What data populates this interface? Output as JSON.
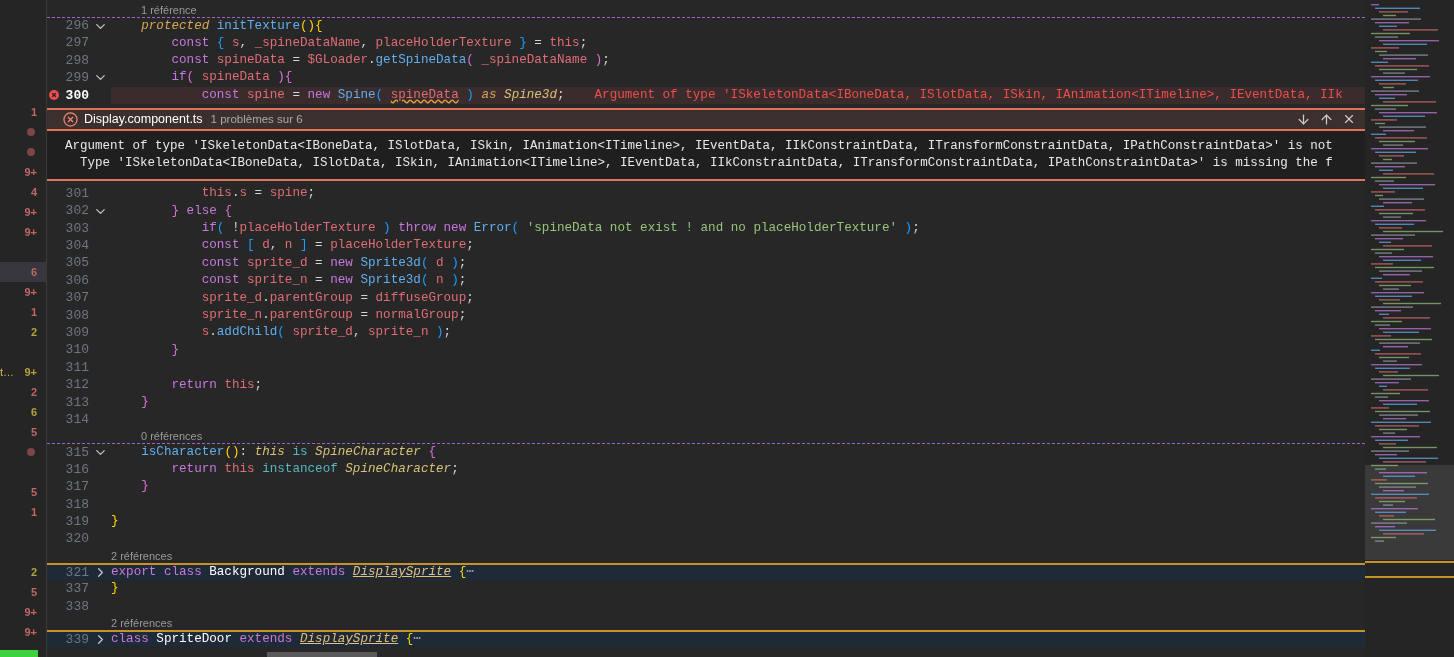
{
  "explorer": {
    "rows": [
      {
        "kind": "count",
        "text": "1",
        "color": "#c26565",
        "selected": false
      },
      {
        "kind": "dot",
        "color": "#7d4545",
        "selected": false
      },
      {
        "kind": "dot",
        "color": "#7d4545",
        "selected": false
      },
      {
        "kind": "count",
        "text": "9+",
        "color": "#c26565",
        "selected": false
      },
      {
        "kind": "count",
        "text": "4",
        "color": "#c26565",
        "selected": false
      },
      {
        "kind": "count",
        "text": "9+",
        "color": "#c26565",
        "selected": false
      },
      {
        "kind": "count",
        "text": "9+",
        "color": "#c26565",
        "selected": false
      },
      {
        "kind": "empty",
        "selected": false
      },
      {
        "kind": "count",
        "text": "6",
        "color": "#c26565",
        "selected": true
      },
      {
        "kind": "count",
        "text": "9+",
        "color": "#c26565",
        "selected": false
      },
      {
        "kind": "count",
        "text": "1",
        "color": "#c26565",
        "selected": false
      },
      {
        "kind": "count",
        "text": "2",
        "color": "#b3a23c",
        "selected": false
      },
      {
        "kind": "empty",
        "selected": false
      },
      {
        "kind": "count",
        "label": "t…",
        "text": "9+",
        "color": "#b3a23c",
        "selected": false
      },
      {
        "kind": "count",
        "text": "2",
        "color": "#c26565",
        "selected": false
      },
      {
        "kind": "count",
        "text": "6",
        "color": "#b3a23c",
        "selected": false
      },
      {
        "kind": "count",
        "text": "5",
        "color": "#c26565",
        "selected": false
      },
      {
        "kind": "dot",
        "color": "#7d4545",
        "selected": false
      },
      {
        "kind": "empty",
        "selected": false
      },
      {
        "kind": "count",
        "text": "5",
        "color": "#c26565",
        "selected": false
      },
      {
        "kind": "count",
        "text": "1",
        "color": "#c26565",
        "selected": false
      },
      {
        "kind": "empty",
        "selected": false
      },
      {
        "kind": "empty",
        "selected": false
      },
      {
        "kind": "count",
        "text": "2",
        "color": "#b3a23c",
        "selected": false
      },
      {
        "kind": "count",
        "text": "5",
        "color": "#c26565",
        "selected": false
      },
      {
        "kind": "count",
        "text": "9+",
        "color": "#c26565",
        "selected": false
      },
      {
        "kind": "count",
        "text": "9+",
        "color": "#c26565",
        "selected": false
      }
    ]
  },
  "editor": {
    "lines": [
      {
        "number": "296",
        "collapsed": false,
        "codelens": "1 référence",
        "tokens": [
          {
            "text": "    protected ",
            "kind": "kwi"
          },
          {
            "text": "initTexture",
            "kind": "fn"
          },
          {
            "text": "(){",
            "kind": "b1"
          }
        ]
      },
      {
        "number": "297",
        "tokens": [
          {
            "text": "        const ",
            "kind": "kw"
          },
          {
            "text": "{ ",
            "kind": "b3"
          },
          {
            "text": "s",
            "kind": "var"
          },
          {
            "text": ", ",
            "kind": "p"
          },
          {
            "text": "_spineDataName",
            "kind": "var"
          },
          {
            "text": ", ",
            "kind": "p"
          },
          {
            "text": "placeHolderTexture ",
            "kind": "var"
          },
          {
            "text": "}",
            "kind": "b3"
          },
          {
            "text": " = ",
            "kind": "p"
          },
          {
            "text": "this",
            "kind": "var"
          },
          {
            "text": ";",
            "kind": "p"
          }
        ]
      },
      {
        "number": "298",
        "tokens": [
          {
            "text": "        const ",
            "kind": "kw"
          },
          {
            "text": "spineData",
            "kind": "var"
          },
          {
            "text": " = ",
            "kind": "p"
          },
          {
            "text": "$GLoader",
            "kind": "var"
          },
          {
            "text": ".",
            "kind": "p"
          },
          {
            "text": "getSpineData",
            "kind": "fn"
          },
          {
            "text": "( ",
            "kind": "b2"
          },
          {
            "text": "_spineDataName ",
            "kind": "var"
          },
          {
            "text": ")",
            "kind": "b2"
          },
          {
            "text": ";",
            "kind": "p"
          }
        ]
      },
      {
        "number": "299",
        "collapsed": false,
        "tokens": [
          {
            "text": "        if",
            "kind": "kw"
          },
          {
            "text": "( ",
            "kind": "b2"
          },
          {
            "text": "spineData ",
            "kind": "var"
          },
          {
            "text": ")",
            "kind": "b2"
          },
          {
            "text": "{",
            "kind": "b2"
          }
        ]
      },
      {
        "number": "300",
        "error": true,
        "diagnostic": "Argument of type 'ISkeletonData<IBoneData, ISlotData, ISkin, IAnimation<ITimeline>, IEventData, IIk",
        "tokens": [
          {
            "text": "            const ",
            "kind": "kw"
          },
          {
            "text": "spine",
            "kind": "var"
          },
          {
            "text": " = ",
            "kind": "p"
          },
          {
            "text": "new ",
            "kind": "kw"
          },
          {
            "text": "Spine",
            "kind": "fn"
          },
          {
            "text": "( ",
            "kind": "b3"
          },
          {
            "text": "spineData",
            "kind": "err"
          },
          {
            "text": " )",
            "kind": "b3"
          },
          {
            "text": " as ",
            "kind": "kwi"
          },
          {
            "text": "Spine3d",
            "kind": "type"
          },
          {
            "text": ";",
            "kind": "p"
          }
        ]
      },
      {
        "number": "301",
        "tokens": [
          {
            "text": "            this",
            "kind": "var"
          },
          {
            "text": ".",
            "kind": "p"
          },
          {
            "text": "s",
            "kind": "var"
          },
          {
            "text": " = ",
            "kind": "p"
          },
          {
            "text": "spine",
            "kind": "var"
          },
          {
            "text": ";",
            "kind": "p"
          }
        ]
      },
      {
        "number": "302",
        "collapsed": false,
        "tokens": [
          {
            "text": "        } ",
            "kind": "b2"
          },
          {
            "text": "else ",
            "kind": "kw"
          },
          {
            "text": "{",
            "kind": "b2"
          }
        ]
      },
      {
        "number": "303",
        "tokens": [
          {
            "text": "            if",
            "kind": "kw"
          },
          {
            "text": "( ",
            "kind": "b3"
          },
          {
            "text": "!",
            "kind": "p"
          },
          {
            "text": "placeHolderTexture ",
            "kind": "var"
          },
          {
            "text": ") ",
            "kind": "b3"
          },
          {
            "text": "throw new ",
            "kind": "kw"
          },
          {
            "text": "Error",
            "kind": "fn"
          },
          {
            "text": "( ",
            "kind": "b3"
          },
          {
            "text": "'spineData not exist ! and no placeHolderTexture'",
            "kind": "str"
          },
          {
            "text": " )",
            "kind": "b3"
          },
          {
            "text": ";",
            "kind": "p"
          }
        ]
      },
      {
        "number": "304",
        "tokens": [
          {
            "text": "            const ",
            "kind": "kw"
          },
          {
            "text": "[ ",
            "kind": "b3"
          },
          {
            "text": "d",
            "kind": "var"
          },
          {
            "text": ", ",
            "kind": "p"
          },
          {
            "text": "n ",
            "kind": "var"
          },
          {
            "text": "]",
            "kind": "b3"
          },
          {
            "text": " = ",
            "kind": "p"
          },
          {
            "text": "placeHolderTexture",
            "kind": "var"
          },
          {
            "text": ";",
            "kind": "p"
          }
        ]
      },
      {
        "number": "305",
        "tokens": [
          {
            "text": "            const ",
            "kind": "kw"
          },
          {
            "text": "sprite_d",
            "kind": "var"
          },
          {
            "text": " = ",
            "kind": "p"
          },
          {
            "text": "new ",
            "kind": "kw"
          },
          {
            "text": "Sprite3d",
            "kind": "fn"
          },
          {
            "text": "( ",
            "kind": "b3"
          },
          {
            "text": "d ",
            "kind": "var"
          },
          {
            "text": ")",
            "kind": "b3"
          },
          {
            "text": ";",
            "kind": "p"
          }
        ]
      },
      {
        "number": "306",
        "tokens": [
          {
            "text": "            const ",
            "kind": "kw"
          },
          {
            "text": "sprite_n",
            "kind": "var"
          },
          {
            "text": " = ",
            "kind": "p"
          },
          {
            "text": "new ",
            "kind": "kw"
          },
          {
            "text": "Sprite3d",
            "kind": "fn"
          },
          {
            "text": "( ",
            "kind": "b3"
          },
          {
            "text": "n ",
            "kind": "var"
          },
          {
            "text": ")",
            "kind": "b3"
          },
          {
            "text": ";",
            "kind": "p"
          }
        ]
      },
      {
        "number": "307",
        "tokens": [
          {
            "text": "            sprite_d",
            "kind": "var"
          },
          {
            "text": ".",
            "kind": "p"
          },
          {
            "text": "parentGroup",
            "kind": "var"
          },
          {
            "text": " = ",
            "kind": "p"
          },
          {
            "text": "diffuseGroup",
            "kind": "var"
          },
          {
            "text": ";",
            "kind": "p"
          }
        ]
      },
      {
        "number": "308",
        "tokens": [
          {
            "text": "            sprite_n",
            "kind": "var"
          },
          {
            "text": ".",
            "kind": "p"
          },
          {
            "text": "parentGroup",
            "kind": "var"
          },
          {
            "text": " = ",
            "kind": "p"
          },
          {
            "text": "normalGroup",
            "kind": "var"
          },
          {
            "text": ";",
            "kind": "p"
          }
        ]
      },
      {
        "number": "309",
        "tokens": [
          {
            "text": "            s",
            "kind": "var"
          },
          {
            "text": ".",
            "kind": "p"
          },
          {
            "text": "addChild",
            "kind": "fn"
          },
          {
            "text": "( ",
            "kind": "b3"
          },
          {
            "text": "sprite_d",
            "kind": "var"
          },
          {
            "text": ", ",
            "kind": "p"
          },
          {
            "text": "sprite_n ",
            "kind": "var"
          },
          {
            "text": ")",
            "kind": "b3"
          },
          {
            "text": ";",
            "kind": "p"
          }
        ]
      },
      {
        "number": "310",
        "tokens": [
          {
            "text": "        }",
            "kind": "b2"
          }
        ]
      },
      {
        "number": "311"
      },
      {
        "number": "312",
        "tokens": [
          {
            "text": "        return ",
            "kind": "kw"
          },
          {
            "text": "this",
            "kind": "var"
          },
          {
            "text": ";",
            "kind": "p"
          }
        ]
      },
      {
        "number": "313",
        "tokens": [
          {
            "text": "    }",
            "kind": "b2"
          }
        ]
      },
      {
        "number": "314"
      },
      {
        "number": "315",
        "collapsed": false,
        "codelens": "0 références",
        "tokens": [
          {
            "text": "    isCharacter",
            "kind": "fn"
          },
          {
            "text": "()",
            "kind": "b1"
          },
          {
            "text": ": ",
            "kind": "p"
          },
          {
            "text": "this ",
            "kind": "type"
          },
          {
            "text": "is ",
            "kind": "cyan"
          },
          {
            "text": "SpineCharacter ",
            "kind": "type"
          },
          {
            "text": "{",
            "kind": "b2"
          }
        ]
      },
      {
        "number": "316",
        "tokens": [
          {
            "text": "        return ",
            "kind": "kw"
          },
          {
            "text": "this ",
            "kind": "var"
          },
          {
            "text": "instanceof ",
            "kind": "cyan"
          },
          {
            "text": "SpineCharacter",
            "kind": "type"
          },
          {
            "text": ";",
            "kind": "p"
          }
        ]
      },
      {
        "number": "317",
        "tokens": [
          {
            "text": "    }",
            "kind": "b2"
          }
        ]
      },
      {
        "number": "318"
      },
      {
        "number": "319",
        "tokens": [
          {
            "text": "}",
            "kind": "b1"
          }
        ]
      },
      {
        "number": "320"
      },
      {
        "number": "321",
        "collapsed": true,
        "codelens": "2 références",
        "tokens": [
          {
            "text": "export class ",
            "kind": "kw"
          },
          {
            "text": "Background ",
            "kind": "cls"
          },
          {
            "text": "extends ",
            "kind": "kw"
          },
          {
            "text": "DisplaySprite",
            "kind": "ul"
          },
          {
            "text": " {",
            "kind": "b1"
          },
          {
            "text": "⋯",
            "kind": "ell"
          }
        ]
      },
      {
        "number": "337",
        "tokens": [
          {
            "text": "}",
            "kind": "b1"
          }
        ]
      },
      {
        "number": "338"
      },
      {
        "number": "339",
        "collapsed": true,
        "codelens": "2 références",
        "tokens": [
          {
            "text": "class ",
            "kind": "kw"
          },
          {
            "text": "SpriteDoor ",
            "kind": "cls"
          },
          {
            "text": "extends ",
            "kind": "kw"
          },
          {
            "text": "DisplaySprite",
            "kind": "ul"
          },
          {
            "text": " {",
            "kind": "b1"
          },
          {
            "text": "⋯",
            "kind": "ell"
          }
        ]
      }
    ]
  },
  "peek": {
    "file": "Display.component.ts",
    "summary": "1 problèmes sur 6",
    "message": [
      "Argument of type 'ISkeletonData<IBoneData, ISlotData, ISkin, IAnimation<ITimeline>, IEventData, IIkConstraintData, ITransformConstraintData, IPathConstraintData>' is not",
      "  Type 'ISkeletonData<IBoneData, ISlotData, ISkin, IAnimation<ITimeline>, IEventData, IIkConstraintData, ITransformConstraintData, IPathConstraintData>' is missing the f"
    ]
  }
}
